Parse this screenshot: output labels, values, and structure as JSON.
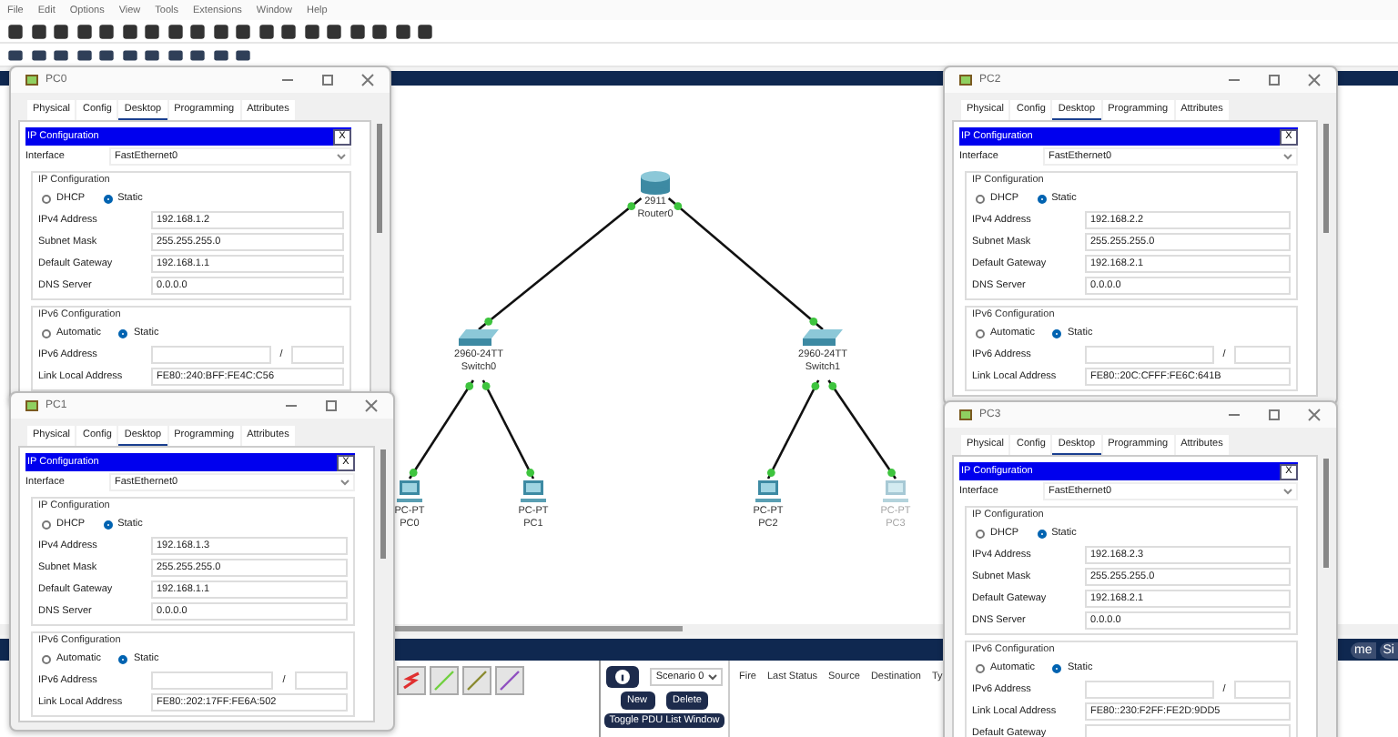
{
  "menu": [
    "File",
    "Edit",
    "Options",
    "View",
    "Tools",
    "Extensions",
    "Window",
    "Help"
  ],
  "topology": {
    "nodes": [
      {
        "kind": "router",
        "model": "2911",
        "name": "Router0",
        "dimmed": false
      },
      {
        "kind": "switch",
        "model": "2960-24TT",
        "name": "Switch0",
        "dimmed": false
      },
      {
        "kind": "switch",
        "model": "2960-24TT",
        "name": "Switch1",
        "dimmed": false
      },
      {
        "kind": "pc",
        "model": "PC-PT",
        "name": "PC0",
        "dimmed": false
      },
      {
        "kind": "pc",
        "model": "PC-PT",
        "name": "PC1",
        "dimmed": false
      },
      {
        "kind": "pc",
        "model": "PC-PT",
        "name": "PC2",
        "dimmed": false
      },
      {
        "kind": "pc",
        "model": "PC-PT",
        "name": "PC3",
        "dimmed": true
      }
    ]
  },
  "mode_bar": [
    "me",
    "Si"
  ],
  "scenario": {
    "select": "Scenario 0",
    "buttons": [
      "New",
      "Delete",
      "Toggle PDU List Window"
    ]
  },
  "pdu_table": {
    "columns": [
      "Fire",
      "Last Status",
      "Source",
      "Destination",
      "Ty"
    ]
  },
  "windows": [
    {
      "title": "PC0",
      "tabs": [
        {
          "label": "Physical",
          "selected": false
        },
        {
          "label": "Config",
          "selected": false
        },
        {
          "label": "Desktop",
          "selected": true
        },
        {
          "label": "Programming",
          "selected": false
        },
        {
          "label": "Attributes",
          "selected": false
        }
      ],
      "dialog": {
        "title": "IP Configuration",
        "close": "X",
        "interface_label": "Interface",
        "interface_value": "FastEthernet0",
        "ipv4": {
          "heading": "IP Configuration",
          "modes": [
            {
              "label": "DHCP",
              "selected": false
            },
            {
              "label": "Static",
              "selected": true
            }
          ],
          "fields": [
            {
              "label": "IPv4 Address",
              "value": "192.168.1.2"
            },
            {
              "label": "Subnet Mask",
              "value": "255.255.255.0"
            },
            {
              "label": "Default Gateway",
              "value": "192.168.1.1"
            },
            {
              "label": "DNS Server",
              "value": "0.0.0.0"
            }
          ]
        },
        "ipv6": {
          "heading": "IPv6 Configuration",
          "modes": [
            {
              "label": "Automatic",
              "selected": false
            },
            {
              "label": "Static",
              "selected": true
            }
          ],
          "fields": [
            {
              "label": "IPv6 Address",
              "kind": "prefix",
              "separator": "/"
            },
            {
              "label": "Link Local Address",
              "kind": "text",
              "value": "FE80::240:BFF:FE4C:C56"
            }
          ]
        }
      }
    },
    {
      "title": "PC1",
      "tabs": [
        {
          "label": "Physical",
          "selected": false
        },
        {
          "label": "Config",
          "selected": false
        },
        {
          "label": "Desktop",
          "selected": true
        },
        {
          "label": "Programming",
          "selected": false
        },
        {
          "label": "Attributes",
          "selected": false
        }
      ],
      "dialog": {
        "title": "IP Configuration",
        "close": "X",
        "interface_label": "Interface",
        "interface_value": "FastEthernet0",
        "ipv4": {
          "heading": "IP Configuration",
          "modes": [
            {
              "label": "DHCP",
              "selected": false
            },
            {
              "label": "Static",
              "selected": true
            }
          ],
          "fields": [
            {
              "label": "IPv4 Address",
              "value": "192.168.1.3"
            },
            {
              "label": "Subnet Mask",
              "value": "255.255.255.0"
            },
            {
              "label": "Default Gateway",
              "value": "192.168.1.1"
            },
            {
              "label": "DNS Server",
              "value": "0.0.0.0"
            }
          ]
        },
        "ipv6": {
          "heading": "IPv6 Configuration",
          "modes": [
            {
              "label": "Automatic",
              "selected": false
            },
            {
              "label": "Static",
              "selected": true
            }
          ],
          "fields": [
            {
              "label": "IPv6 Address",
              "kind": "prefix",
              "separator": "/"
            },
            {
              "label": "Link Local Address",
              "kind": "text",
              "value": "FE80::202:17FF:FE6A:502"
            }
          ]
        }
      }
    },
    {
      "title": "PC2",
      "tabs": [
        {
          "label": "Physical",
          "selected": false
        },
        {
          "label": "Config",
          "selected": false
        },
        {
          "label": "Desktop",
          "selected": true
        },
        {
          "label": "Programming",
          "selected": false
        },
        {
          "label": "Attributes",
          "selected": false
        }
      ],
      "dialog": {
        "title": "IP Configuration",
        "close": "X",
        "interface_label": "Interface",
        "interface_value": "FastEthernet0",
        "ipv4": {
          "heading": "IP Configuration",
          "modes": [
            {
              "label": "DHCP",
              "selected": false
            },
            {
              "label": "Static",
              "selected": true
            }
          ],
          "fields": [
            {
              "label": "IPv4 Address",
              "value": "192.168.2.2"
            },
            {
              "label": "Subnet Mask",
              "value": "255.255.255.0"
            },
            {
              "label": "Default Gateway",
              "value": "192.168.2.1"
            },
            {
              "label": "DNS Server",
              "value": "0.0.0.0"
            }
          ]
        },
        "ipv6": {
          "heading": "IPv6 Configuration",
          "modes": [
            {
              "label": "Automatic",
              "selected": false
            },
            {
              "label": "Static",
              "selected": true
            }
          ],
          "fields": [
            {
              "label": "IPv6 Address",
              "kind": "prefix",
              "separator": "/"
            },
            {
              "label": "Link Local Address",
              "kind": "text",
              "value": "FE80::20C:CFFF:FE6C:641B"
            }
          ]
        }
      }
    },
    {
      "title": "PC3",
      "tabs": [
        {
          "label": "Physical",
          "selected": false
        },
        {
          "label": "Config",
          "selected": false
        },
        {
          "label": "Desktop",
          "selected": true
        },
        {
          "label": "Programming",
          "selected": false
        },
        {
          "label": "Attributes",
          "selected": false
        }
      ],
      "dialog": {
        "title": "IP Configuration",
        "close": "X",
        "interface_label": "Interface",
        "interface_value": "FastEthernet0",
        "ipv4": {
          "heading": "IP Configuration",
          "modes": [
            {
              "label": "DHCP",
              "selected": false
            },
            {
              "label": "Static",
              "selected": true
            }
          ],
          "fields": [
            {
              "label": "IPv4 Address",
              "value": "192.168.2.3"
            },
            {
              "label": "Subnet Mask",
              "value": "255.255.255.0"
            },
            {
              "label": "Default Gateway",
              "value": "192.168.2.1"
            },
            {
              "label": "DNS Server",
              "value": "0.0.0.0"
            }
          ]
        },
        "ipv6": {
          "heading": "IPv6 Configuration",
          "modes": [
            {
              "label": "Automatic",
              "selected": false
            },
            {
              "label": "Static",
              "selected": true
            }
          ],
          "fields": [
            {
              "label": "IPv6 Address",
              "kind": "prefix",
              "separator": "/"
            },
            {
              "label": "Link Local Address",
              "kind": "text",
              "value": "FE80::230:F2FF:FE2D:9DD5"
            },
            {
              "label": "Default Gateway",
              "kind": "text"
            }
          ]
        }
      }
    }
  ]
}
